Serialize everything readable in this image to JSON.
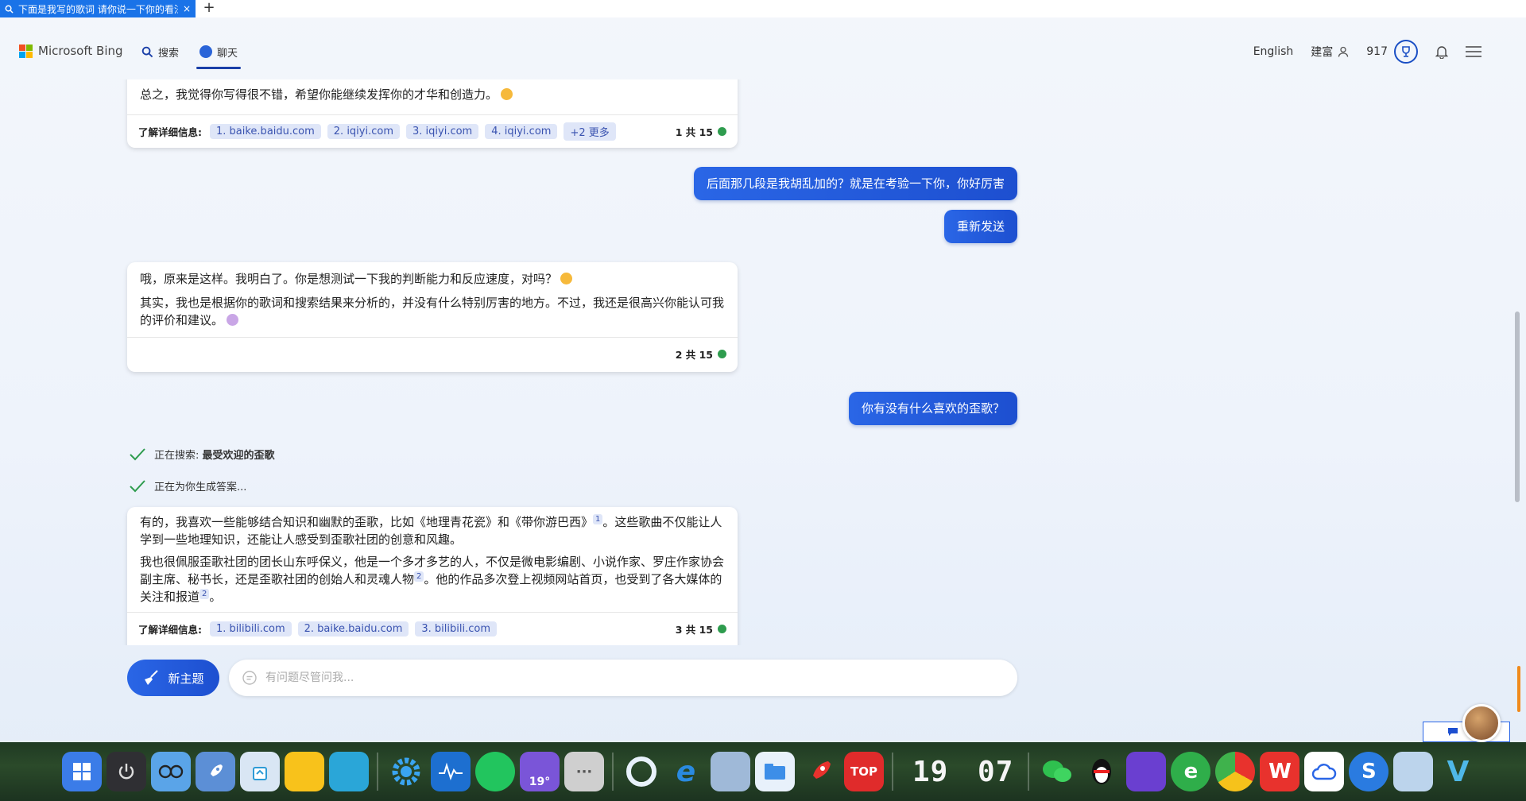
{
  "browser": {
    "tab_title": "下面是我写的歌词 请你说一下你的看法",
    "close_glyph": "×",
    "new_tab_glyph": "+"
  },
  "header": {
    "brand": "Microsoft Bing",
    "nav": [
      {
        "label": "搜索",
        "icon": "search-icon",
        "active": false
      },
      {
        "label": "聊天",
        "icon": "chat-icon",
        "active": true
      }
    ],
    "language": "English",
    "user_name": "建富",
    "reward_points": "917"
  },
  "messages": {
    "m1": {
      "text": "总之，我觉得你写得很不错，希望你能继续发挥你的才华和创造力。",
      "learn_more_label": "了解详细信息:",
      "sources": [
        "1. baike.baidu.com",
        "2. iqiyi.com",
        "3. iqiyi.com",
        "4. iqiyi.com",
        "+2 更多"
      ],
      "counter": "1 共 15"
    },
    "u1": "后面那几段是我胡乱加的？就是在考验一下你，你好厉害",
    "resend": "重新发送",
    "m2": {
      "p1": "哦，原来是这样。我明白了。你是想测试一下我的判断能力和反应速度，对吗？",
      "p2": "其实，我也是根据你的歌词和搜索结果来分析的，并没有什么特别厉害的地方。不过，我还是很高兴你能认可我的评价和建议。",
      "counter": "2 共 15"
    },
    "u2": "你有没有什么喜欢的歪歌？",
    "status1_prefix": "正在搜索: ",
    "status1_query": "最受欢迎的歪歌",
    "status2": "正在为你生成答案...",
    "m3": {
      "p1a": "有的，我喜欢一些能够结合知识和幽默的歪歌，比如《地理青花瓷》和《带你游巴西》",
      "p1_ref": "1",
      "p1b": "。这些歌曲不仅能让人学到一些地理知识，还能让人感受到歪歌社团的创意和风趣。",
      "p2a": "我也很佩服歪歌社团的团长山东呼保义，他是一个多才多艺的人，不仅是微电影编剧、小说作家、罗庄作家协会副主席、秘书长，还是歪歌社团的创始人和灵魂人物",
      "p2_ref": "2",
      "p2b": "。他的作品多次登上视频网站首页，也受到了各大媒体的关注和报道",
      "p2_ref2": "2",
      "p2c": "。",
      "learn_more_label": "了解详细信息:",
      "sources": [
        "1. bilibili.com",
        "2. baike.baidu.com",
        "3. bilibili.com"
      ],
      "counter": "3 共 15"
    }
  },
  "composer": {
    "new_topic": "新主题",
    "placeholder": "有问题尽管问我..."
  },
  "taskbar": {
    "clock_hour": "19",
    "clock_min": "07",
    "weather_temp": "19°",
    "top_badge": "TOP",
    "more_glyph": "···"
  },
  "colors": {
    "accent": "#1d4fd0",
    "chip_bg": "#dfe6f8",
    "chip_text": "#3a53b0",
    "success": "#2e9c4e"
  }
}
